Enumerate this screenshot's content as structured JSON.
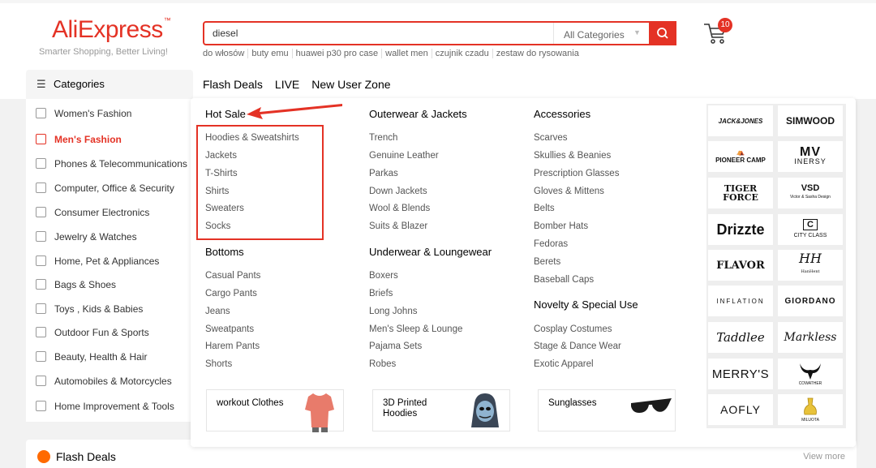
{
  "logo": {
    "text": "AliExpress",
    "tm": "™",
    "slogan": "Smarter Shopping, Better Living!"
  },
  "search": {
    "value": "diesel",
    "category": "All Categories"
  },
  "hotwords": [
    "do włosów",
    "buty emu",
    "huawei p30 pro case",
    "wallet men",
    "czujnik czadu",
    "zestaw do rysowania"
  ],
  "cart": {
    "count": "10"
  },
  "categories_header": "Categories",
  "nav": [
    "Flash Deals",
    "LIVE",
    "New User Zone"
  ],
  "sidebar": [
    {
      "label": "Women's Fashion",
      "icon": "dress-icon"
    },
    {
      "label": "Men's Fashion",
      "icon": "shirt-icon",
      "active": true
    },
    {
      "label": "Phones & Telecommunications",
      "icon": "phone-icon"
    },
    {
      "label": "Computer, Office & Security",
      "icon": "laptop-icon"
    },
    {
      "label": "Consumer Electronics",
      "icon": "camera-icon"
    },
    {
      "label": "Jewelry & Watches",
      "icon": "ring-icon"
    },
    {
      "label": "Home, Pet & Appliances",
      "icon": "sofa-icon"
    },
    {
      "label": "Bags & Shoes",
      "icon": "bag-icon"
    },
    {
      "label": "Toys , Kids & Babies",
      "icon": "bottle-icon"
    },
    {
      "label": "Outdoor Fun & Sports",
      "icon": "ball-icon"
    },
    {
      "label": "Beauty, Health & Hair",
      "icon": "lipstick-icon"
    },
    {
      "label": "Automobiles & Motorcycles",
      "icon": "wheel-icon"
    },
    {
      "label": "Home Improvement & Tools",
      "icon": "tool-icon"
    }
  ],
  "menu": {
    "col1": {
      "title1": "Hot Sale",
      "items1": [
        "Hoodies & Sweatshirts",
        "Jackets",
        "T-Shirts",
        "Shirts",
        "Sweaters",
        "Socks"
      ],
      "title2": "Bottoms",
      "items2": [
        "Casual Pants",
        "Cargo Pants",
        "Jeans",
        "Sweatpants",
        "Harem Pants",
        "Shorts"
      ]
    },
    "col2": {
      "title1": "Outerwear & Jackets",
      "items1": [
        "Trench",
        "Genuine Leather",
        "Parkas",
        "Down Jackets",
        "Wool & Blends",
        "Suits & Blazer"
      ],
      "title2": "Underwear & Loungewear",
      "items2": [
        "Boxers",
        "Briefs",
        "Long Johns",
        "Men's Sleep & Lounge",
        "Pajama Sets",
        "Robes"
      ]
    },
    "col3": {
      "title1": "Accessories",
      "items1": [
        "Scarves",
        "Skullies & Beanies",
        "Prescription Glasses",
        "Gloves & Mittens",
        "Belts",
        "Bomber Hats",
        "Fedoras",
        "Berets",
        "Baseball Caps"
      ],
      "title2": "Novelty & Special Use",
      "items2": [
        "Cosplay Costumes",
        "Stage & Dance Wear",
        "Exotic Apparel"
      ]
    }
  },
  "promos": [
    {
      "label": "workout Clothes"
    },
    {
      "label1": "3D Printed",
      "label2": "Hoodies"
    },
    {
      "label": "Sunglasses"
    }
  ],
  "brands": [
    "JACK&JONES",
    "SIMWOOD",
    "PIONEER CAMP",
    "INERSY",
    "TIGER FORCE",
    "VSD",
    "Drizzte",
    "CITY CLASS",
    "FLAVOR",
    "HH",
    "INFLATION",
    "GIORDANO",
    "Taddlee",
    "Markless",
    "MERRY'S",
    "COWATHER",
    "AOFLY",
    "MILUOTA"
  ],
  "brand_subtexts": {
    "vsd": "Victor & Sasha Design",
    "hh": "HanHent"
  },
  "flash_deals": {
    "title": "Flash Deals",
    "view_more": "View more"
  },
  "colors": {
    "brand": "#e43225",
    "accent": "#ff6a00"
  }
}
